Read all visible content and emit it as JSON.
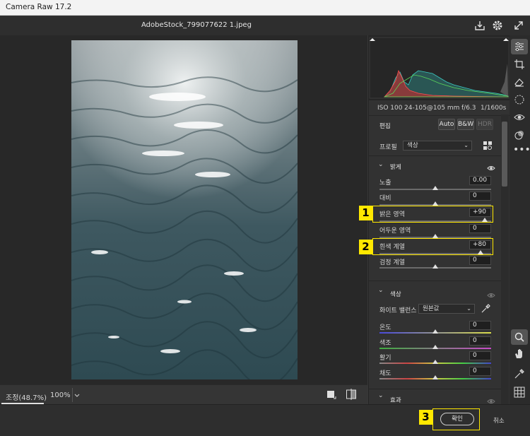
{
  "window": {
    "title": "Camera Raw 17.2"
  },
  "toolbar": {
    "filename": "AdobeStock_799077622 1.jpeg",
    "icons": [
      "save-icon",
      "settings-icon",
      "fullscreen-icon"
    ]
  },
  "histogram": {
    "exif": {
      "iso": "ISO 100",
      "lens": "24-105@105 mm",
      "aperture": "f/6.3",
      "shutter": "1/1600s"
    }
  },
  "edit": {
    "title": "편집",
    "buttons": {
      "auto": "Auto",
      "bw": "B&W",
      "hdr": "HDR"
    },
    "profile_label": "프로필",
    "profile_value": "색상"
  },
  "light": {
    "title": "밝게",
    "sliders": [
      {
        "label": "노출",
        "value": "0.00"
      },
      {
        "label": "대비",
        "value": "0"
      },
      {
        "label": "밝은 영역",
        "value": "+90"
      },
      {
        "label": "어두운 영역",
        "value": "0"
      },
      {
        "label": "흰색 계열",
        "value": "+80"
      },
      {
        "label": "검정 계열",
        "value": "0"
      }
    ]
  },
  "color": {
    "title": "색상",
    "wb_label": "화이트 밸런스",
    "wb_value": "원본값",
    "sliders": [
      {
        "label": "온도",
        "value": "0"
      },
      {
        "label": "색조",
        "value": "0"
      },
      {
        "label": "활기",
        "value": "0"
      },
      {
        "label": "채도",
        "value": "0"
      }
    ]
  },
  "effects": {
    "title": "효과"
  },
  "bottombar": {
    "zoom_label": "조정(48.7%)",
    "zoom_pct": "100%"
  },
  "footer": {
    "ok": "확인",
    "cancel": "취소"
  },
  "callouts": [
    "1",
    "2",
    "3"
  ],
  "colors": {
    "callout": "#ffe800",
    "panel": "#323232",
    "canvas": "#282828"
  }
}
